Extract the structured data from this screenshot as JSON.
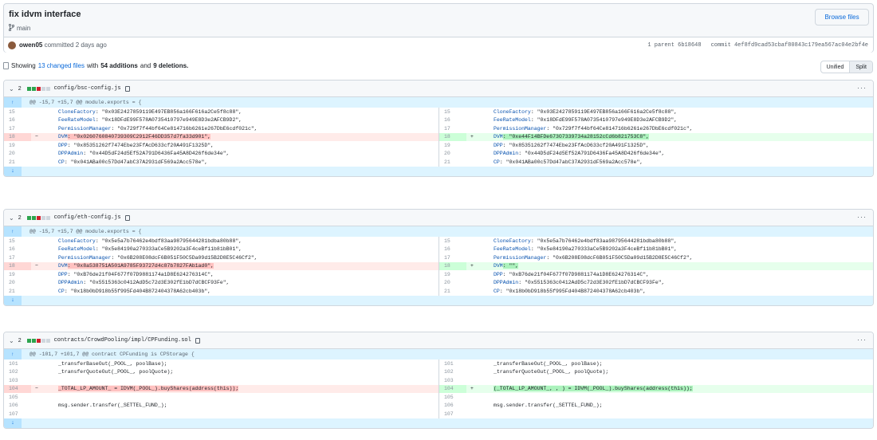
{
  "commit": {
    "title": "fix idvm interface",
    "branch": "main",
    "browse_label": "Browse files",
    "author": "owen05",
    "committed": "committed 2 days ago",
    "parent": "1 parent 6b18648",
    "commit_hash": "commit 4ef8fd9cad53cbaf80843c179ea567ac04e2bf4e"
  },
  "summary": {
    "prefix": "Showing",
    "changed": "13 changed files",
    "with": "with",
    "additions": "54 additions",
    "and": "and",
    "deletions": "9 deletions."
  },
  "view": {
    "unified": "Unified",
    "split": "Split"
  },
  "colors": {
    "add": "#2da44e",
    "del": "#cf222e",
    "neutral": "#d0d7de"
  },
  "files": [
    {
      "count": "2",
      "path": "config/bsc-config.js",
      "hunk": "@@ -15,7 +15,7 @@ module.exports = {",
      "rows": [
        {
          "ln": "15",
          "lk": "CloneFactory",
          "lv": ": \"0x03E2427859119E497EB856a166F616a2Ce5f8c88\",",
          "rn": "15",
          "rk": "CloneFactory",
          "rv": ": \"0x03E2427859119E497EB856a166F616a2Ce5f8c88\","
        },
        {
          "ln": "16",
          "lk": "FeeRateModel",
          "lv": ": \"0x18DFdE99F578A0735410797e949E8D3e2AFCB9D2\",",
          "rn": "16",
          "rk": "FeeRateModel",
          "rv": ": \"0x18DFdE99F578A0735410797e949E8D3e2AFCB9D2\","
        },
        {
          "ln": "17",
          "lk": "PermissionManager",
          "lv": ": \"0x729f7f44bf64Ce814716b6261e267DbE6cdf021c\",",
          "rn": "17",
          "rk": "PermissionManager",
          "rv": ": \"0x729f7f44bf64Ce814716b6261e267DbE6cdf021c\","
        },
        {
          "ln": "18",
          "lk": "DVM",
          "lv": ": \"0x0260760840739309C2912F46DD357d7fa33d901\",",
          "rn": "18",
          "rk": "DVM",
          "rv": ": \"0xe44F14BFDe673O7339734a28152cCd6b821753C8\",",
          "changed": true
        },
        {
          "ln": "19",
          "lk": "DPP",
          "lv": ": \"0x85351262f7474Ebe23FfAcD633cf20A491F1325D\",",
          "rn": "19",
          "rk": "DPP",
          "rv": ": \"0x85351262f7474Ebe23FfAcD633cf20A491F1325D\","
        },
        {
          "ln": "20",
          "lk": "DPPAdmin",
          "lv": ": \"0x44D5dF24d5Ef52A791D6436Fa45A8D426f6de34e\",",
          "rn": "20",
          "rk": "DPPAdmin",
          "rv": ": \"0x44D5dF24d5Ef52A791D6436Fa45A8D426f6de34e\","
        },
        {
          "ln": "21",
          "lk": "CP",
          "lv": ": \"0x041ABa00c57Dd47abC37A2931dF569a2Acc578e\",",
          "rn": "21",
          "rk": "CP",
          "rv": ": \"0x041ABa00c57Dd47abC37A2931dF569a2Acc578e\","
        }
      ]
    },
    {
      "count": "2",
      "path": "config/eth-config.js",
      "hunk": "@@ -15,7 +15,7 @@ module.exports = {",
      "rows": [
        {
          "ln": "15",
          "lk": "CloneFactory",
          "lv": ": \"0x5e5a7b76462e4bdf83aa98795644281bdba80b88\",",
          "rn": "15",
          "rk": "CloneFactory",
          "rv": ": \"0x5e5a7b76462e4bdf83aa98795644281bdba80b88\","
        },
        {
          "ln": "16",
          "lk": "FeeRateModel",
          "lv": ": \"0x5e84190a270333aCe5B9202a3F4ceBf11b81bB01\",",
          "rn": "16",
          "rk": "FeeRateModel",
          "rv": ": \"0x5e84190a270333aCe5B9202a3F4ceBf11b81bB01\","
        },
        {
          "ln": "17",
          "lk": "PermissionManager",
          "lv": ": \"0x6B208E08dcF6B051F50C5Da09d15B2D8E5C46Cf2\",",
          "rn": "17",
          "rk": "PermissionManager",
          "rv": ": \"0x6B208E08dcF6B051F50C5Da09d15B2D8E5C46Cf2\","
        },
        {
          "ln": "18",
          "lk": "DVM",
          "lv": ": \"0x8a538751A501A9785F93727d4c87b7827FAb1ad0\",",
          "rn": "18",
          "rk": "DVM",
          "rv": ": \"\",",
          "changed": true
        },
        {
          "ln": "19",
          "lk": "DPP",
          "lv": ": \"0xB76de21f04F677f07D9881174a1D8E624276314C\",",
          "rn": "19",
          "rk": "DPP",
          "rv": ": \"0xB76de21f04F677f07D9881174a1D8E624276314C\","
        },
        {
          "ln": "20",
          "lk": "DPPAdmin",
          "lv": ": \"0x5515363c0412AdD5c72d3E302fE1bD7dCBCF93Fe\",",
          "rn": "20",
          "rk": "DPPAdmin",
          "rv": ": \"0x5515363c0412AdD5c72d3E302fE1bD7dCBCF93Fe\","
        },
        {
          "ln": "21",
          "lk": "CP",
          "lv": ": \"0x18b0bD918b55f995Fd404B872404378A62cb403b\",",
          "rn": "21",
          "rk": "CP",
          "rv": ": \"0x18b0bD918b55f995Fd404B872404378A62cb403b\","
        }
      ]
    },
    {
      "count": "2",
      "path": "contracts/CrowdPooling/impl/CPFunding.sol",
      "hunk": "@@ -101,7 +101,7 @@ contract CPFunding is CPStorage {",
      "rows": [
        {
          "ln": "101",
          "lk": "",
          "lv": "_transferBaseOut(_POOL_, poolBase);",
          "rn": "101",
          "rk": "",
          "rv": "_transferBaseOut(_POOL_, poolBase);"
        },
        {
          "ln": "102",
          "lk": "",
          "lv": "_transferQuoteOut(_POOL_, poolQuote);",
          "rn": "102",
          "rk": "",
          "rv": "_transferQuoteOut(_POOL_, poolQuote);"
        },
        {
          "ln": "103",
          "lk": "",
          "lv": "",
          "rn": "103",
          "rk": "",
          "rv": ""
        },
        {
          "ln": "104",
          "lk": "",
          "lv": "_TOTAL_LP_AMOUNT_ = IDVM(_POOL_).buyShares(address(this));",
          "rn": "104",
          "rk": "",
          "rv": "(_TOTAL_LP_AMOUNT_, , ) = IDVM(_POOL_).buyShares(address(this));",
          "changed": true
        },
        {
          "ln": "105",
          "lk": "",
          "lv": "",
          "rn": "105",
          "rk": "",
          "rv": ""
        },
        {
          "ln": "106",
          "lk": "",
          "lv": "msg.sender.transfer(_SETTEL_FUND_);",
          "rn": "106",
          "rk": "",
          "rv": "msg.sender.transfer(_SETTEL_FUND_);"
        },
        {
          "ln": "107",
          "lk": "",
          "lv": "",
          "rn": "107",
          "rk": "",
          "rv": ""
        }
      ]
    }
  ]
}
